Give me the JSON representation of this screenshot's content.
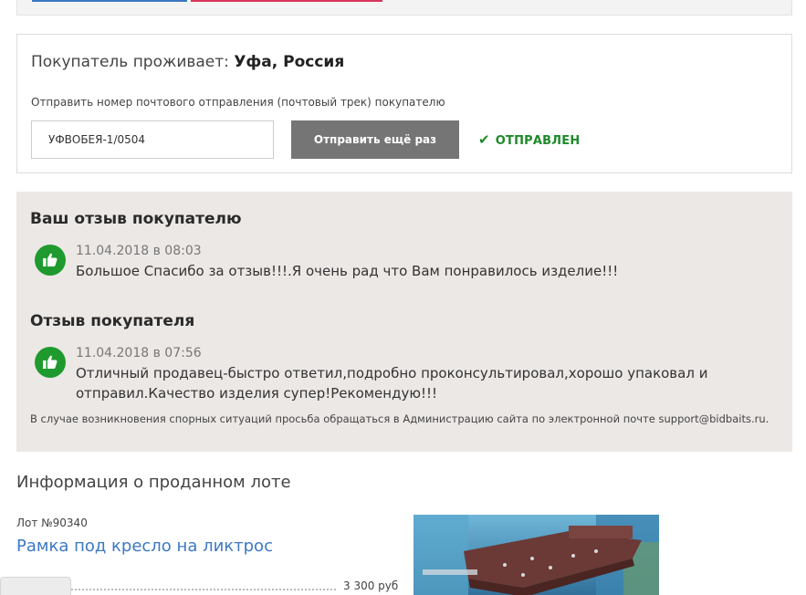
{
  "buyer": {
    "prefix": "Покупатель проживает:",
    "location": "Уфа, Россия"
  },
  "tracking": {
    "caption": "Отправить номер почтового отправления (почтовый трек) покупателю",
    "value": "УФВОБЕЯ-1/0504",
    "resend_label": "Отправить ещё раз",
    "status_label": "ОТПРАВЛЕН",
    "status_icon": "check-icon",
    "status_color": "#1e8a2a"
  },
  "reviews": {
    "your_heading": "Ваш отзыв покупателю",
    "your_review": {
      "date": "11.04.2018 в 08:03",
      "text": "Большое Спасибо за отзыв!!!.Я очень рад что Вам понравилось изделие!!!",
      "icon": "thumbs-up-icon"
    },
    "buyer_heading": "Отзыв покупателя",
    "buyer_review": {
      "date": "11.04.2018 в 07:56",
      "text": "Отличный продавец-быстро ответил,подробно проконсультировал,хорошо упаковал и отправил.Качество изделия супер!Рекомендую!!!",
      "icon": "thumbs-up-icon"
    },
    "support_note": "В случае возникновения спорных ситуаций просьба обращаться в Администрацию сайта по электронной почте support@bidbaits.ru."
  },
  "lot": {
    "heading": "Информация о проданном лоте",
    "number": "Лот №90340",
    "title": "Рамка под кресло на ликтрос",
    "price": "3 300 руб"
  },
  "colors": {
    "accent_green": "#1f9a2e",
    "link_blue": "#3d78c4",
    "button_gray": "#757575",
    "review_bg": "#ece8e6"
  }
}
